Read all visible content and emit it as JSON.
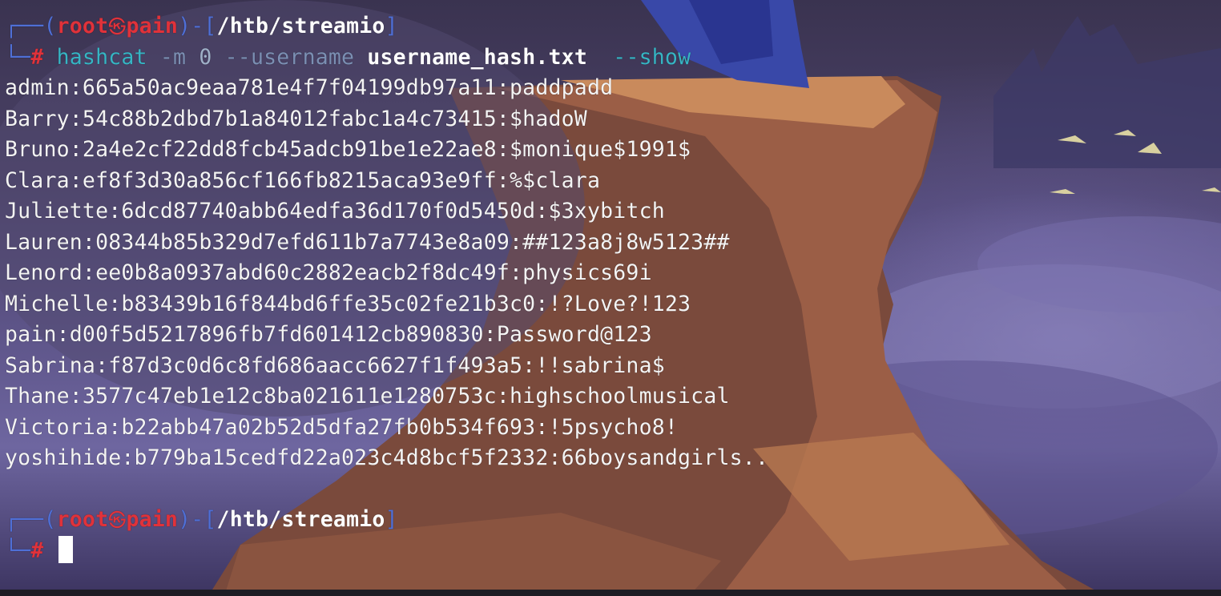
{
  "prompt": {
    "user": "root",
    "separator_icon": "skull-icon",
    "host": "pain",
    "path": "/htb/streamio",
    "symbol": "#"
  },
  "command": {
    "program": "hashcat",
    "mode_flag": "-m",
    "mode_value": "0",
    "username_flag": "--username",
    "file": "username_hash.txt",
    "show_flag": "--show"
  },
  "output_lines": [
    "admin:665a50ac9eaa781e4f7f04199db97a11:paddpadd",
    "Barry:54c88b2dbd7b1a84012fabc1a4c73415:$hadoW",
    "Bruno:2a4e2cf22dd8fcb45adcb91be1e22ae8:$monique$1991$",
    "Clara:ef8f3d30a856cf166fb8215aca93e9ff:%$clara",
    "Juliette:6dcd87740abb64edfa36d170f0d5450d:$3xybitch",
    "Lauren:08344b85b329d7efd611b7a7743e8a09:##123a8j8w5123##",
    "Lenord:ee0b8a0937abd60c2882eacb2f8dc49f:physics69i",
    "Michelle:b83439b16f844bd6ffe35c02fe21b3c0:!?Love?!123",
    "pain:d00f5d5217896fb7fd601412cb890830:Password@123",
    "Sabrina:f87d3c0d6c8fd686aacc6627f1f493a5:!!sabrina$",
    "Thane:3577c47eb1e12c8ba021611e1280753c:highschoolmusical",
    "Victoria:b22abb47a02b52d5dfa27fb0b534f693:!5psycho8!",
    "yoshihide:b779ba15cedfd22a023c4d8bcf5f2332:66boysandgirls.."
  ],
  "colors": {
    "prompt_box": "#4f6fd6",
    "prompt_user": "#e0323a",
    "command": "#36b5c4",
    "output_text": "#f4f4f4"
  }
}
